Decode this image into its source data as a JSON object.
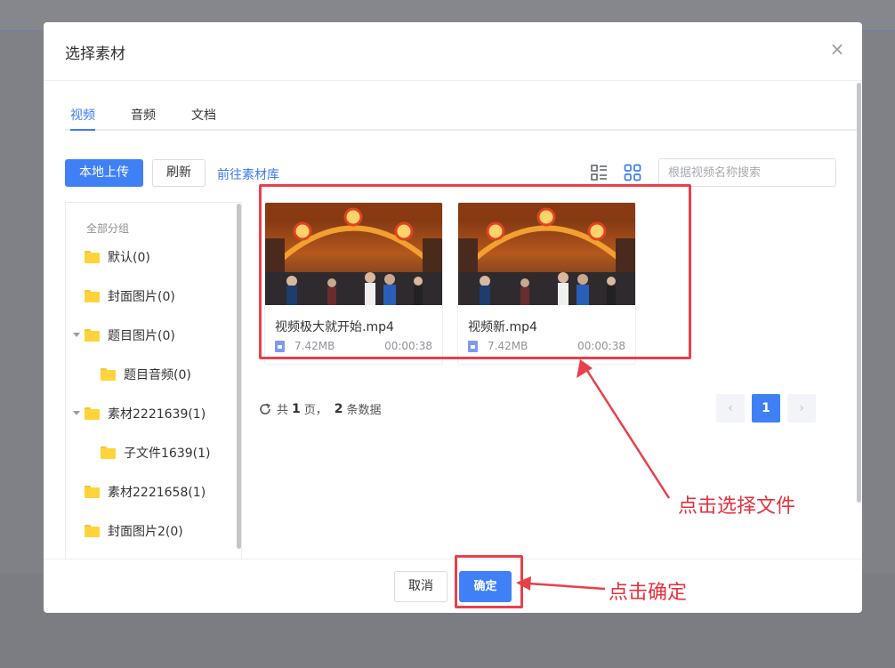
{
  "dialog": {
    "title": "选择素材",
    "close_icon": "close-icon"
  },
  "tabs": [
    {
      "label": "视频",
      "active": true
    },
    {
      "label": "音频",
      "active": false
    },
    {
      "label": "文档",
      "active": false
    }
  ],
  "toolbar": {
    "upload_label": "本地上传",
    "refresh_label": "刷新",
    "library_link": "前往素材库",
    "list_view_icon": "list-view-icon",
    "grid_view_icon": "grid-view-icon",
    "search_placeholder": "根据视频名称搜索"
  },
  "groups": {
    "header": "全部分组",
    "items": [
      {
        "label": "默认(0)",
        "level": 0,
        "expanded": null
      },
      {
        "label": "封面图片(0)",
        "level": 0,
        "expanded": null
      },
      {
        "label": "题目图片(0)",
        "level": 0,
        "expanded": true
      },
      {
        "label": "题目音频(0)",
        "level": 1,
        "expanded": null
      },
      {
        "label": "素材2221639(1)",
        "level": 0,
        "expanded": true
      },
      {
        "label": "子文件1639(1)",
        "level": 1,
        "expanded": null
      },
      {
        "label": "素材2221658(1)",
        "level": 0,
        "expanded": null
      },
      {
        "label": "封面图片2(0)",
        "level": 0,
        "expanded": null
      }
    ]
  },
  "files": [
    {
      "name": "视频极大就开始.mp4",
      "size": "7.42MB",
      "duration": "00:00:38"
    },
    {
      "name": "视频新.mp4",
      "size": "7.42MB",
      "duration": "00:00:38"
    }
  ],
  "pagination": {
    "prefix": "共",
    "pages": "1",
    "page_unit": "页，",
    "count": "2",
    "count_unit": "条数据",
    "current_page": "1",
    "prev_icon": "chevron-left-icon",
    "next_icon": "chevron-right-icon",
    "refresh_icon": "refresh-icon"
  },
  "footer": {
    "cancel_label": "取消",
    "confirm_label": "确定"
  },
  "annotations": {
    "select_file": "点击选择文件",
    "confirm": "点击确定",
    "color": "#e8404b"
  },
  "colors": {
    "primary": "#3f80f7",
    "link": "#3a7af2",
    "folder": "#ffd43b"
  }
}
